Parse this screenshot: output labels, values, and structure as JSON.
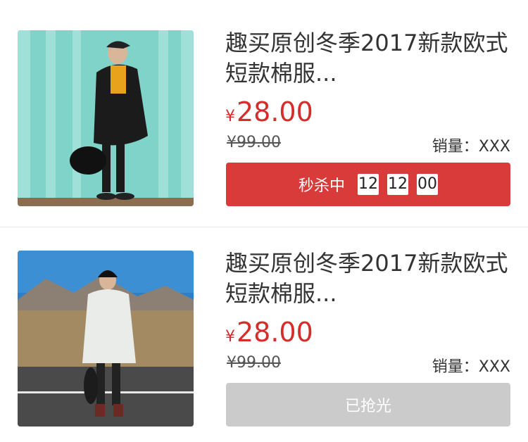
{
  "products": [
    {
      "title": "趣买原创冬季2017新款欧式短款棉服...",
      "currency": "¥",
      "price": "28.00",
      "original_price": "¥99.00",
      "sales_label": "销量：XXX",
      "status": "秒杀中",
      "countdown": [
        "12",
        "12",
        "00"
      ]
    },
    {
      "title": "趣买原创冬季2017新款欧式短款棉服...",
      "currency": "¥",
      "price": "28.00",
      "original_price": "¥99.00",
      "sales_label": "销量：XXX",
      "status": "已抢光"
    }
  ],
  "colors": {
    "price": "#d42d2a",
    "active_button": "#d93b3b",
    "soldout_button": "#cbcbcb"
  }
}
